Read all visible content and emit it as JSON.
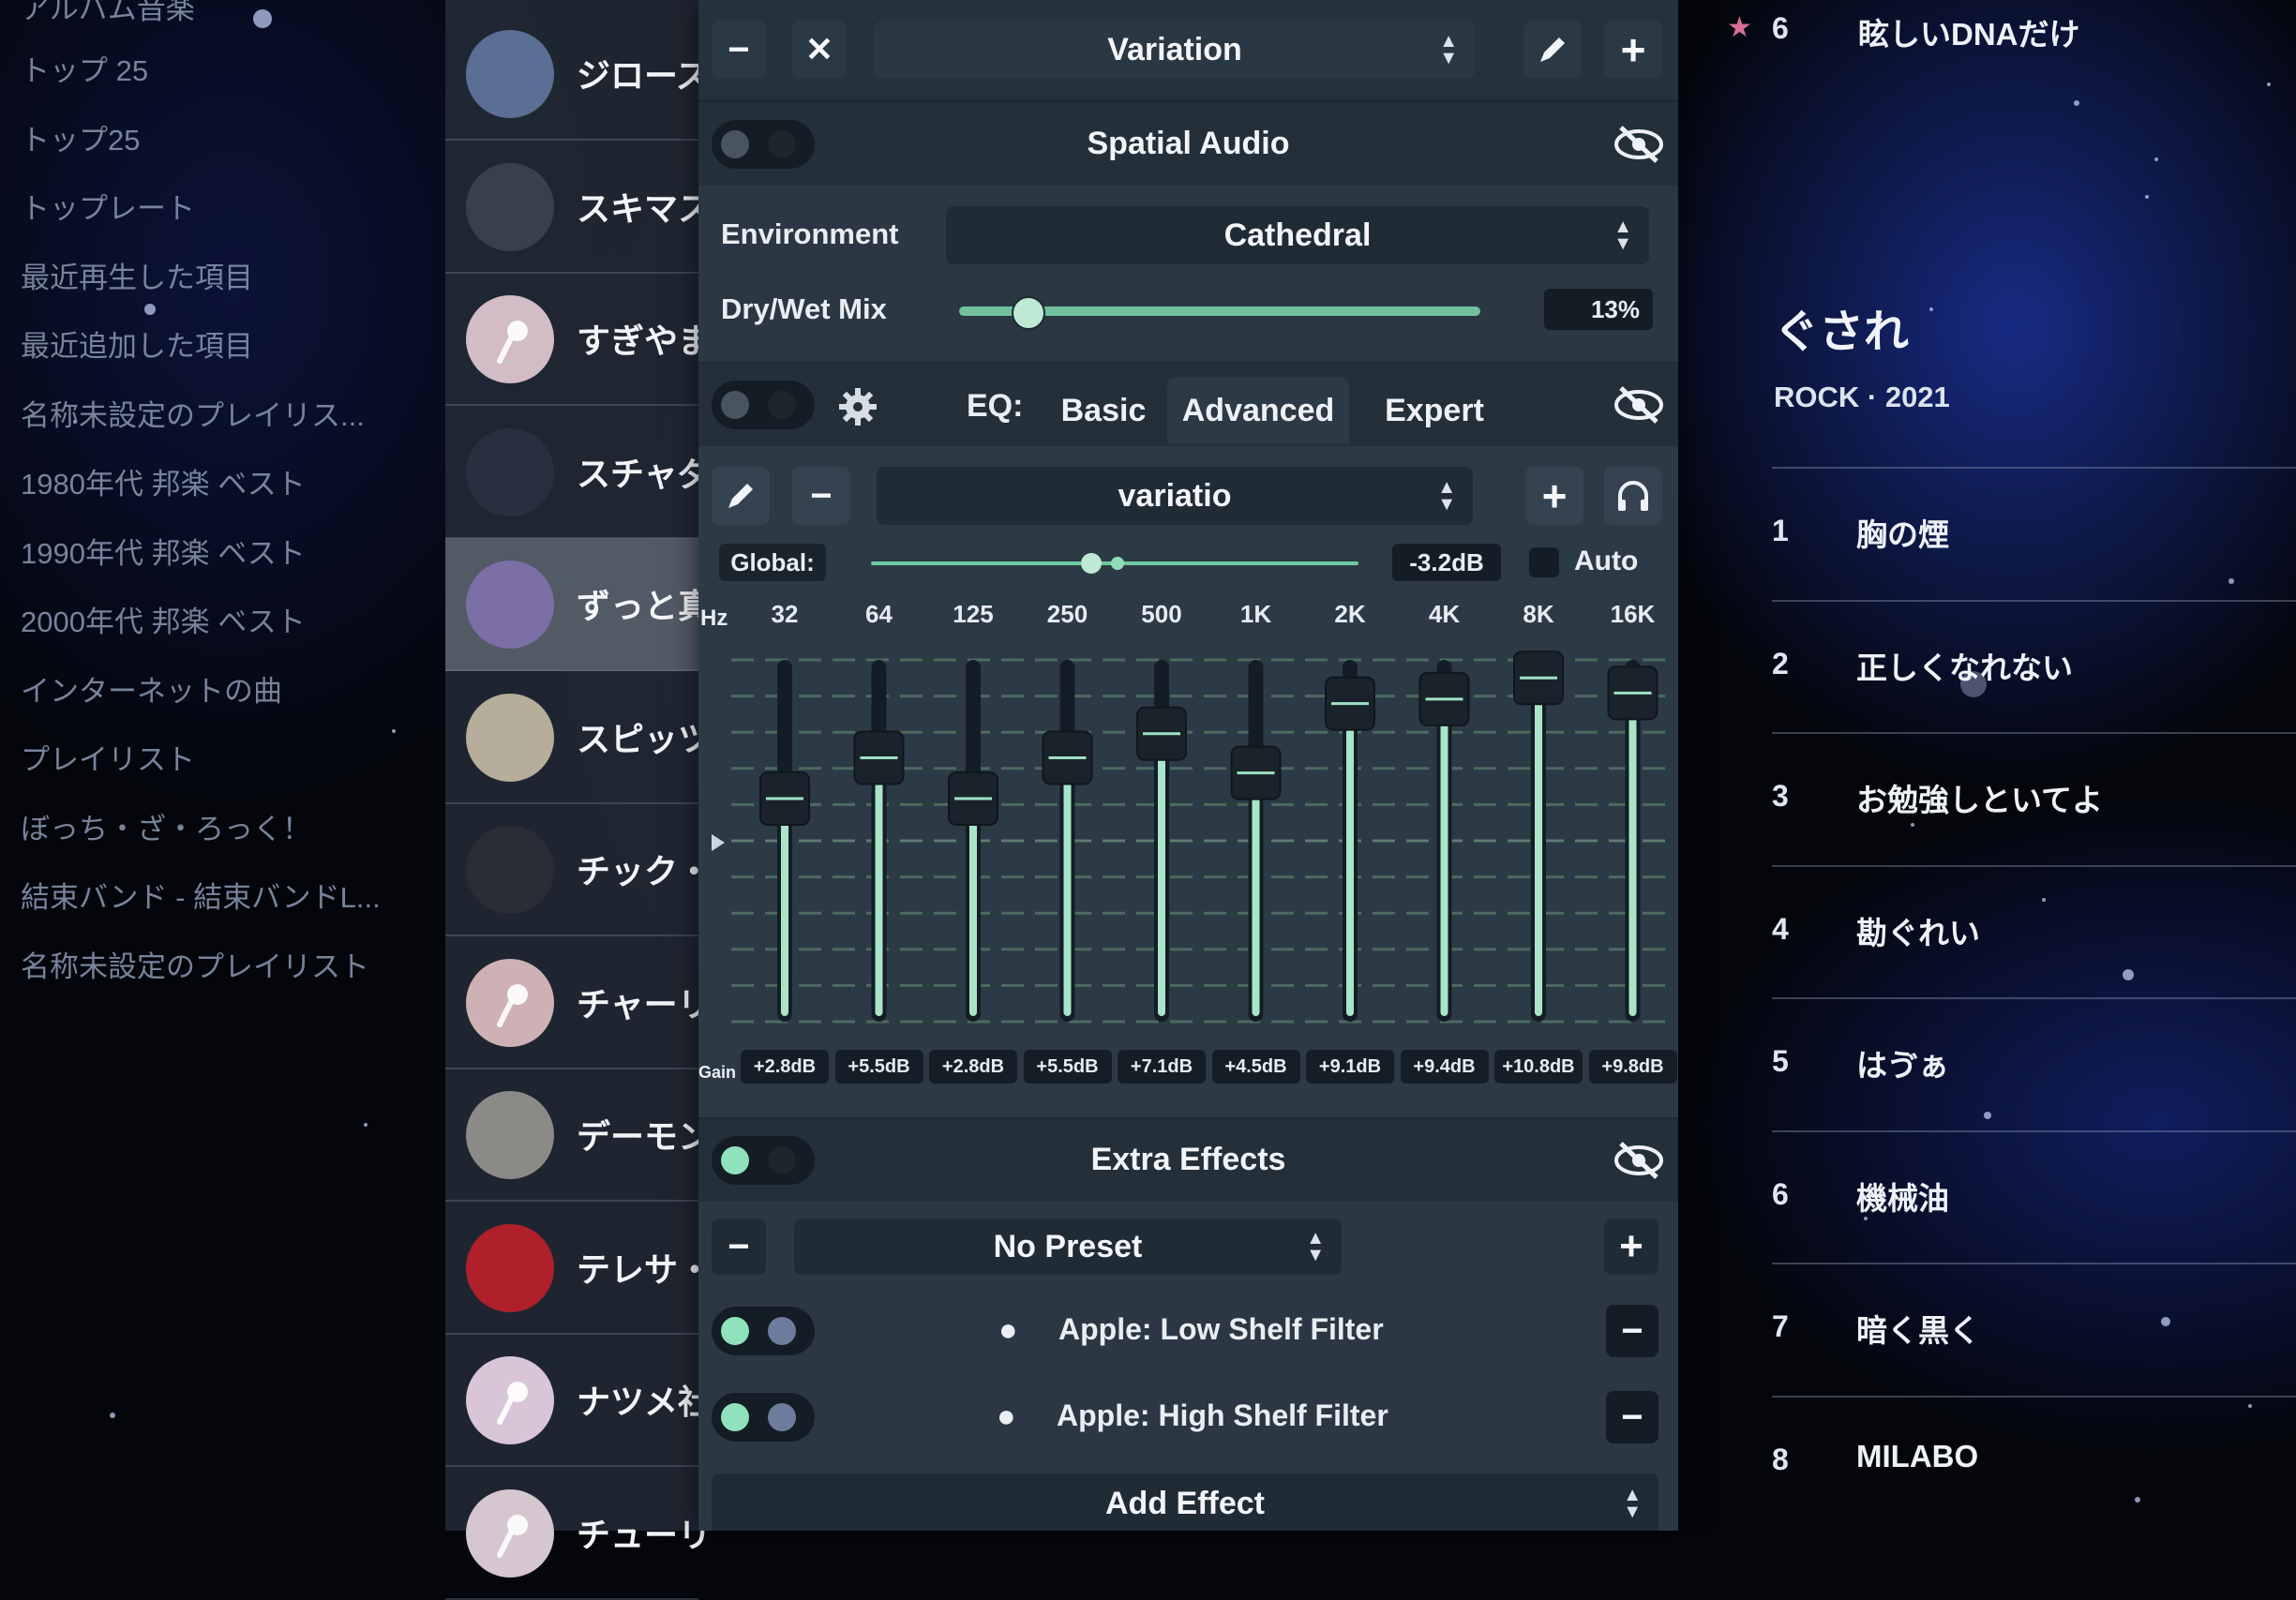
{
  "left_sidebar": {
    "partial_top": "アルバム音楽",
    "items": [
      "トップ 25",
      "トップ25",
      "トップレート",
      "最近再生した項目",
      "最近追加した項目",
      "名称未設定のプレイリス...",
      "1980年代 邦楽 ベスト",
      "1990年代 邦楽 ベスト",
      "2000年代 邦楽 ベスト",
      "インターネットの曲",
      "プレイリスト",
      "ぼっち・ざ・ろっく！",
      "結束バンド - 結束バンドL...",
      "名称未設定のプレイリスト"
    ]
  },
  "artists": [
    "ジローズ",
    "スキマス",
    "すぎやま",
    "スチャダ",
    "ずっと真",
    "スピッツ",
    "チック・",
    "チャーリ",
    "デーモン",
    "テレサ・",
    "ナツメ社",
    "チューリ"
  ],
  "panel": {
    "top_bar": {
      "preset": "Variation"
    },
    "spatial": {
      "title": "Spatial Audio",
      "environment_label": "Environment",
      "environment_value": "Cathedral",
      "mix_label": "Dry/Wet Mix",
      "mix_value": "13%",
      "mix_fraction": 0.13
    },
    "eq": {
      "prefix": "EQ:",
      "tabs": [
        "Basic",
        "Advanced",
        "Expert"
      ],
      "active_tab": "Advanced",
      "preset": "variatio",
      "global_label": "Global:",
      "global_value": "-3.2dB",
      "auto_label": "Auto",
      "hz_label": "Hz",
      "gain_label": "Gain",
      "bands": [
        "32",
        "64",
        "125",
        "250",
        "500",
        "1K",
        "2K",
        "4K",
        "8K",
        "16K"
      ],
      "gains": [
        "+2.8dB",
        "+5.5dB",
        "+2.8dB",
        "+5.5dB",
        "+7.1dB",
        "+4.5dB",
        "+9.1dB",
        "+9.4dB",
        "+10.8dB",
        "+9.8dB"
      ],
      "gain_values": [
        2.8,
        5.5,
        2.8,
        5.5,
        7.1,
        4.5,
        9.1,
        9.4,
        10.8,
        9.8
      ],
      "gain_range": [
        -12,
        12
      ]
    },
    "extra": {
      "title": "Extra Effects",
      "preset": "No Preset",
      "effects": [
        "Apple: Low Shelf Filter",
        "Apple: High Shelf Filter"
      ],
      "add_label": "Add Effect"
    }
  },
  "right_column": {
    "top_track": {
      "num": "6",
      "title": "眩しいDNAだけ"
    },
    "album_title": "ぐされ",
    "album_meta": "ROCK · 2021",
    "tracks": [
      {
        "num": "1",
        "title": "胸の煙"
      },
      {
        "num": "2",
        "title": "正しくなれない"
      },
      {
        "num": "3",
        "title": "お勉強しといてよ"
      },
      {
        "num": "4",
        "title": "勘ぐれい"
      },
      {
        "num": "5",
        "title": "はゔぁ"
      },
      {
        "num": "6",
        "title": "機械油"
      },
      {
        "num": "7",
        "title": "暗く黒く"
      },
      {
        "num": "8",
        "title": "MILABO"
      }
    ]
  },
  "colors": {
    "accent": "#7fd9b0",
    "panel": "#1e2a35"
  }
}
